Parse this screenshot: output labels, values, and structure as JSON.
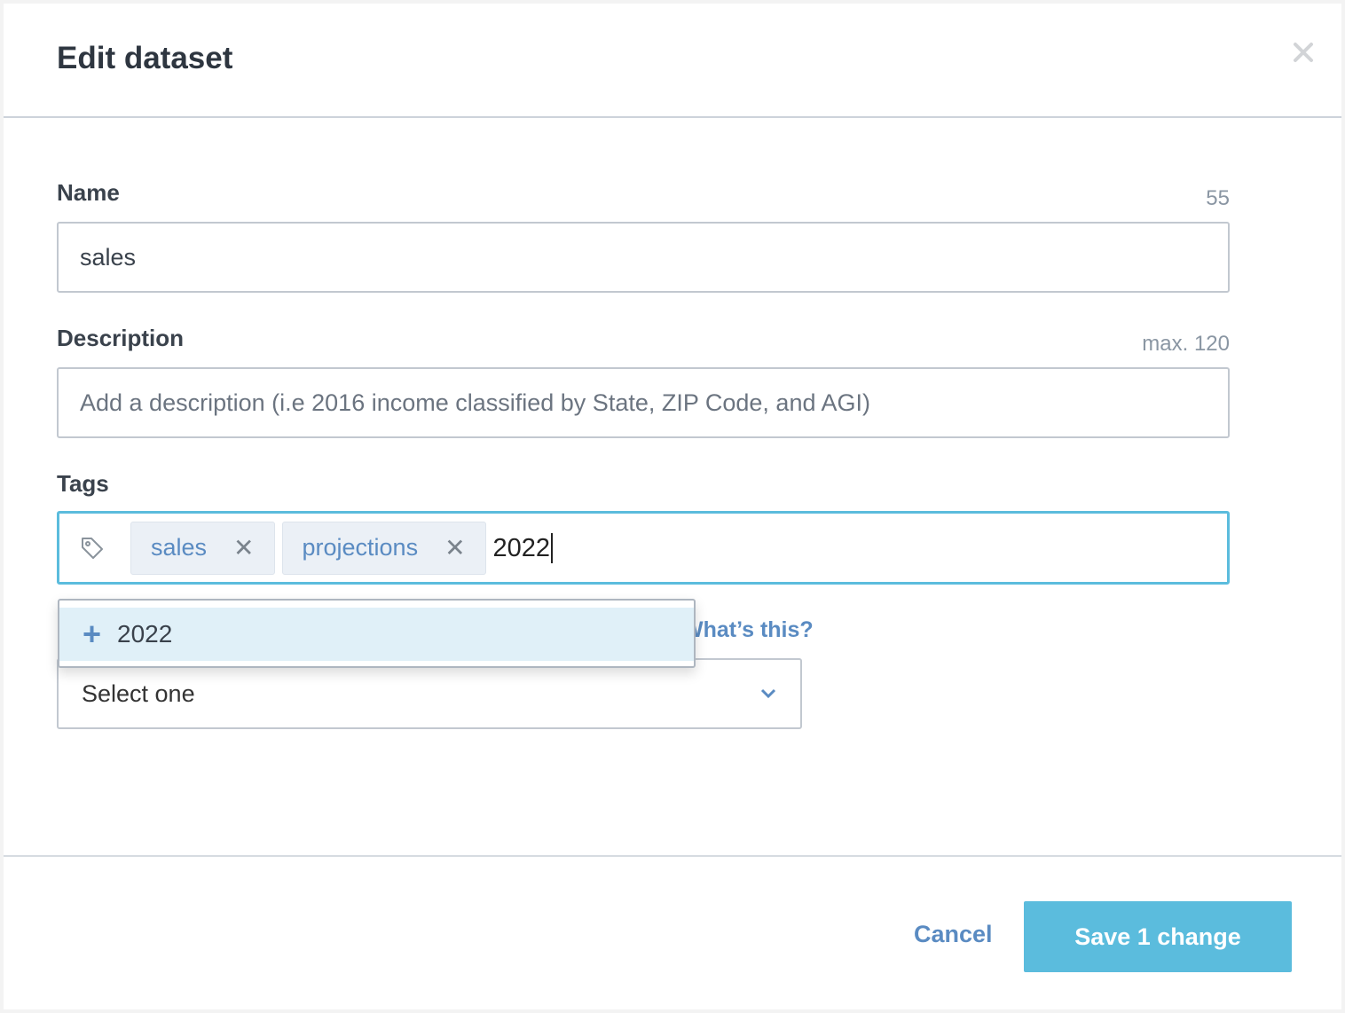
{
  "dialog": {
    "title": "Edit dataset"
  },
  "name": {
    "label": "Name",
    "counter": "55",
    "value": "sales"
  },
  "description": {
    "label": "Description",
    "hint": "max. 120",
    "placeholder": "Add a description (i.e 2016 income classified by State, ZIP Code, and AGI)"
  },
  "tags": {
    "label": "Tags",
    "items": [
      {
        "label": "sales"
      },
      {
        "label": "projections"
      }
    ],
    "typed": "2022",
    "remove_glyph": "✕"
  },
  "suggestion": {
    "label": "2022",
    "icon": "plus-icon"
  },
  "help_link": "What’s this?",
  "select": {
    "value": "Select one"
  },
  "footer": {
    "cancel": "Cancel",
    "save": "Save 1 change"
  },
  "colors": {
    "accent": "#5bbcdd",
    "link": "#5a8bc2"
  }
}
